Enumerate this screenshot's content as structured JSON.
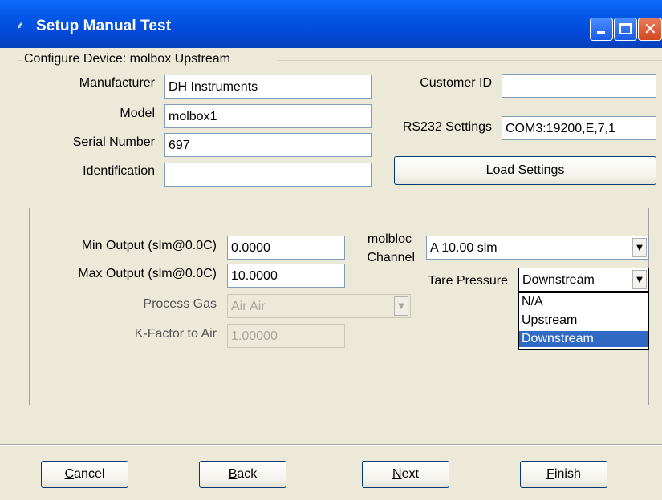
{
  "window": {
    "title": "Setup Manual Test",
    "icon": "wand-icon"
  },
  "device_group": {
    "caption": "Configure Device: molbox Upstream",
    "manufacturer_label": "Manufacturer",
    "manufacturer_value": "DH Instruments",
    "model_label": "Model",
    "model_value": "molbox1",
    "serial_label": "Serial Number",
    "serial_value": "697",
    "identification_label": "Identification",
    "identification_value": "",
    "customer_id_label": "Customer ID",
    "customer_id_value": "",
    "rs232_label": "RS232 Settings",
    "rs232_value": "COM3:19200,E,7,1",
    "load_settings_pre": "",
    "load_settings_key": "L",
    "load_settings_post": "oad Settings"
  },
  "output_panel": {
    "min_output_label": "Min Output (slm@0.0C)",
    "min_output_value": "0.0000",
    "max_output_label": "Max Output (slm@0.0C)",
    "max_output_value": "10.0000",
    "process_gas_label": "Process Gas",
    "process_gas_value": "Air Air",
    "kfactor_label": "K-Factor to Air",
    "kfactor_value": "1.00000",
    "molbloc_label_1": "molbloc",
    "molbloc_label_2": "Channel",
    "molbloc_value": "A 10.00 slm",
    "tare_label": "Tare Pressure",
    "tare_value": "Downstream",
    "tare_options": [
      "N/A",
      "Upstream",
      "Downstream"
    ],
    "tare_selected_index": 2
  },
  "buttons": {
    "cancel": {
      "key": "C",
      "rest": "ancel"
    },
    "back": {
      "key": "B",
      "rest": "ack"
    },
    "next": {
      "key": "N",
      "rest": "ext"
    },
    "finish": {
      "key": "F",
      "rest": "inish"
    }
  },
  "colors": {
    "titlebar": "#0558e6",
    "face": "#ece9d8",
    "selection": "#316ac5",
    "close": "#d44720"
  }
}
